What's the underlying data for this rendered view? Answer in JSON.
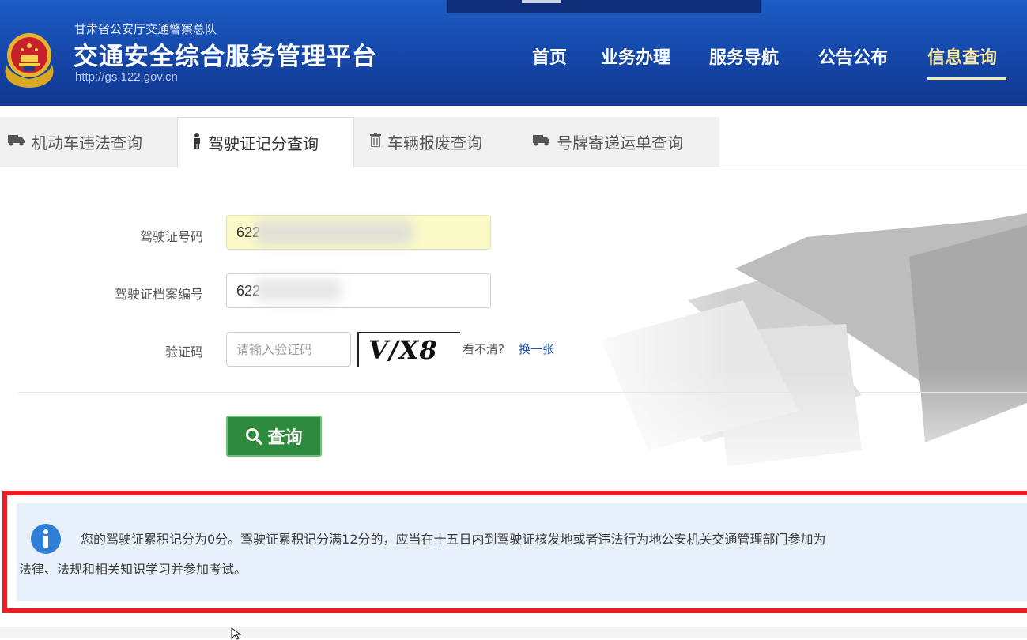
{
  "header": {
    "org_name": "甘肃省公安厅交通警察总队",
    "platform_title": "交通安全综合服务管理平台",
    "url": "http://gs.122.gov.cn",
    "colors": {
      "background": "#1546a8",
      "active_nav": "#f6e7a3"
    }
  },
  "nav": {
    "items": [
      "首页",
      "业务办理",
      "服务导航",
      "公告公布",
      "信息查询"
    ],
    "active": "信息查询"
  },
  "tabs": [
    {
      "label": "机动车违法查询",
      "icon": "truck-icon"
    },
    {
      "label": "驾驶证记分查询",
      "icon": "person-icon",
      "active": true
    },
    {
      "label": "车辆报废查询",
      "icon": "trash-icon"
    },
    {
      "label": "号牌寄递运单查询",
      "icon": "truck-icon"
    }
  ],
  "form": {
    "license_number_label": "驾驶证号码",
    "license_number_value": "622",
    "file_number_label": "驾驶证档案编号",
    "file_number_value": "622",
    "captcha_label": "验证码",
    "captcha_placeholder": "请输入验证码",
    "captcha_image_text": "V/X8",
    "captcha_hint": "看不清?",
    "captcha_refresh": "换一张",
    "query_button": "查询"
  },
  "result": {
    "line1": "您的驾驶证累积记分为0分。驾驶证累积记分满12分的，应当在十五日内到驾驶证核发地或者违法行为地公安机关交通管理部门参加为",
    "line2": "法律、法规和相关知识学习并参加考试。",
    "icon": "info-icon",
    "highlight_color": "#ee1c25"
  }
}
